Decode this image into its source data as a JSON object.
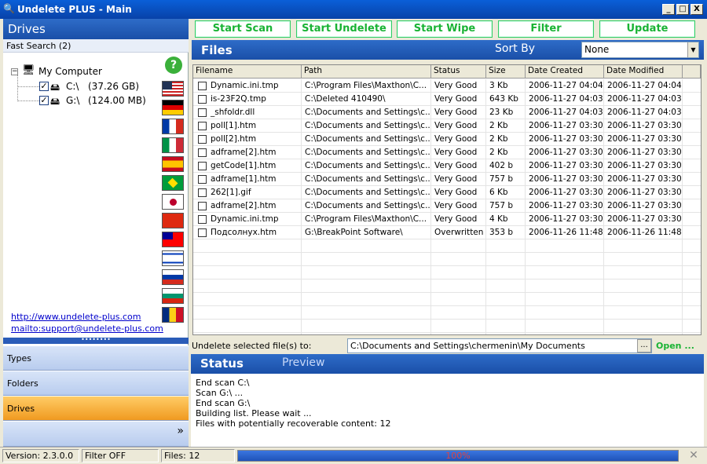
{
  "window": {
    "title": "Undelete PLUS - Main",
    "minimize": "_",
    "maximize": "□",
    "close": "X"
  },
  "left": {
    "drives_title": "Drives",
    "fast_search": "Fast Search (2)",
    "tree": {
      "root": "My Computer",
      "drives": [
        {
          "name": "C:\\",
          "size": "(37.26 GB)",
          "checked": true
        },
        {
          "name": "G:\\",
          "size": "(124.00 MB)",
          "checked": true
        }
      ]
    },
    "flags": [
      "us",
      "de",
      "fr",
      "it",
      "es",
      "br",
      "jp",
      "cn",
      "tw",
      "il",
      "ru",
      "bg",
      "ro"
    ],
    "links": {
      "website": "http://www.undelete-plus.com",
      "email": "mailto:support@undelete-plus.com"
    },
    "splitter": "••••••••",
    "nav": [
      {
        "label": "Types",
        "active": false
      },
      {
        "label": "Folders",
        "active": false
      },
      {
        "label": "Drives",
        "active": true
      }
    ],
    "more": "»"
  },
  "toolbar": {
    "start_scan": "Start Scan",
    "start_undelete": "Start Undelete",
    "start_wipe": "Start Wipe",
    "filter": "Filter",
    "update": "Update"
  },
  "files": {
    "title": "Files",
    "sort_by_label": "Sort By",
    "sort_by_value": "None",
    "columns": [
      "Filename",
      "Path",
      "Status",
      "Size",
      "Date Created",
      "Date Modified"
    ],
    "rows": [
      [
        "Dynamic.ini.tmp",
        "C:\\Program Files\\Maxthon\\C...",
        "Very Good",
        "3 Kb",
        "2006-11-27 04:04",
        "2006-11-27 04:04"
      ],
      [
        "is-23F2Q.tmp",
        "C:\\Deleted 410490\\",
        "Very Good",
        "643 Kb",
        "2006-11-27 04:03",
        "2006-11-27 04:03"
      ],
      [
        "_shfoldr.dll",
        "C:\\Documents and Settings\\c...",
        "Very Good",
        "23 Kb",
        "2006-11-27 04:03",
        "2006-11-27 04:03"
      ],
      [
        "poll[1].htm",
        "C:\\Documents and Settings\\c...",
        "Very Good",
        "2 Kb",
        "2006-11-27 03:30",
        "2006-11-27 03:30"
      ],
      [
        "poll[2].htm",
        "C:\\Documents and Settings\\c...",
        "Very Good",
        "2 Kb",
        "2006-11-27 03:30",
        "2006-11-27 03:30"
      ],
      [
        "adframe[2].htm",
        "C:\\Documents and Settings\\c...",
        "Very Good",
        "2 Kb",
        "2006-11-27 03:30",
        "2006-11-27 03:30"
      ],
      [
        "getCode[1].htm",
        "C:\\Documents and Settings\\c...",
        "Very Good",
        "402 b",
        "2006-11-27 03:30",
        "2006-11-27 03:30"
      ],
      [
        "adframe[1].htm",
        "C:\\Documents and Settings\\c...",
        "Very Good",
        "757 b",
        "2006-11-27 03:30",
        "2006-11-27 03:30"
      ],
      [
        "262[1].gif",
        "C:\\Documents and Settings\\c...",
        "Very Good",
        "6 Kb",
        "2006-11-27 03:30",
        "2006-11-27 03:30"
      ],
      [
        "adframe[2].htm",
        "C:\\Documents and Settings\\c...",
        "Very Good",
        "757 b",
        "2006-11-27 03:30",
        "2006-11-27 03:30"
      ],
      [
        "Dynamic.ini.tmp",
        "C:\\Program Files\\Maxthon\\C...",
        "Very Good",
        "4 Kb",
        "2006-11-27 03:30",
        "2006-11-27 03:30"
      ],
      [
        "Подсолнух.htm",
        "G:\\BreakPoint Software\\",
        "Overwritten",
        "353 b",
        "2006-11-26 11:48",
        "2006-11-26 11:48"
      ]
    ]
  },
  "undelete": {
    "label": "Undelete selected file(s) to:",
    "path": "C:\\Documents and Settings\\chermenin\\My Documents",
    "browse": "...",
    "open": "Open ..."
  },
  "status": {
    "tab_status": "Status",
    "tab_preview": "Preview",
    "log": [
      "End scan C:\\",
      "Scan G:\\ ...",
      "End scan G:\\",
      "Building list. Please wait ...",
      "Files with potentially recoverable content: 12"
    ]
  },
  "statusbar": {
    "version": "Version: 2.3.0.0",
    "filter": "Filter OFF",
    "files": "Files: 12",
    "progress_text": "100%",
    "progress": 1.0,
    "close": "✕"
  }
}
